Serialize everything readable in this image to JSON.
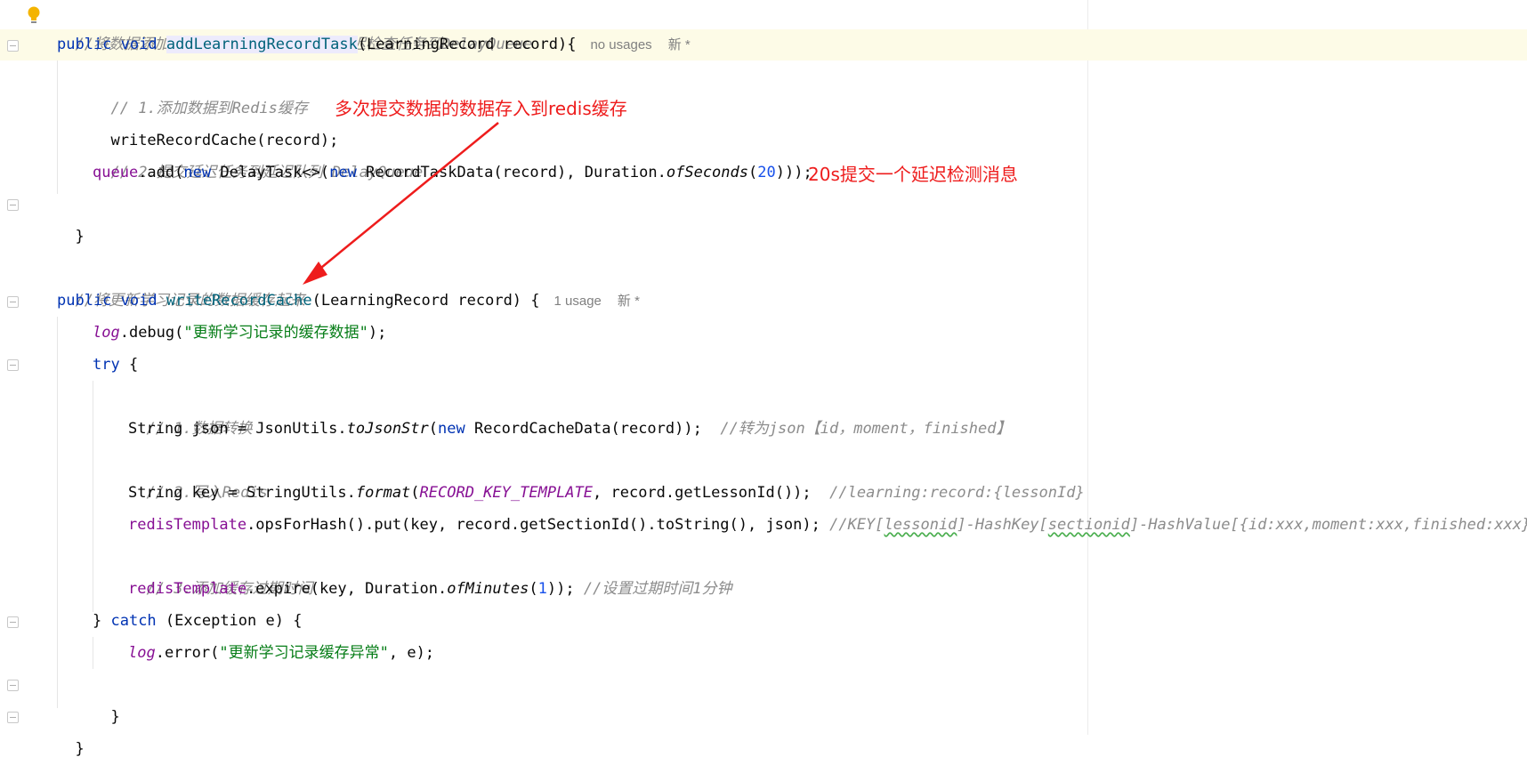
{
  "editor": {
    "lines": {
      "l1_comment": "//将数据添加到redis，并且添加一个延迟检查任务到DelayQueue",
      "l2_public": "public",
      "l2_void": "void",
      "l2_method": "addLearningRecordTask",
      "l2_params": "(LearningRecord record){",
      "l2_usages": "no usages",
      "l2_new": "新 *",
      "l3_comment": "// 1.添加数据到Redis缓存",
      "l4_code": "writeRecordCache(record);",
      "l5_comment": "// 2.提交延迟任务到延迟队列 DelayQueue",
      "l6_queue": "queue",
      "l6_add": ".add(",
      "l6_new1": "new",
      "l6_delay": " DelayTask<>(",
      "l6_new2": "new",
      "l6_rtd": " RecordTaskData(record), Duration.",
      "l6_ofsec": "ofSeconds",
      "l6_open": "(",
      "l6_num": "20",
      "l6_close": ")));",
      "l7_brace": "}",
      "l9_comment": "//将更新学习记录的数据缓存起来",
      "l10_public": "public",
      "l10_void": "void",
      "l10_method": "writeRecordCache",
      "l10_params": "(LearningRecord record) {",
      "l10_usages": "1 usage",
      "l10_new": "新 *",
      "l11_log": "log",
      "l11_debug": ".debug(",
      "l11_str": "\"更新学习记录的缓存数据\"",
      "l11_end": ");",
      "l12_try": "try",
      "l12_brace": " {",
      "l13_comment": "// 1.数据转换",
      "l14_a": "String json = JsonUtils.",
      "l14_tojson": "toJsonStr",
      "l14_b": "(",
      "l14_new": "new",
      "l14_c": " RecordCacheData(record));",
      "l14_comment": "//转为json【id，moment，finished】",
      "l15_comment": "// 2.写入Redis",
      "l16_a": "String key = StringUtils.",
      "l16_format": "format",
      "l16_b": "(",
      "l16_const": "RECORD_KEY_TEMPLATE",
      "l16_c": ", record.getLessonId());",
      "l16_comment": "//learning:record:{lessonId}",
      "l17_field": "redisTemplate",
      "l17_a": ".opsForHash().put(key, record.getSectionId().toString(), json);",
      "l17_c1": "//KEY[",
      "l17_c2": "lessonid",
      "l17_c3": "]-HashKey[",
      "l17_c4": "sectionid",
      "l17_c5": "]-HashValue[{id:xxx,moment:xxx,finished:xxx}]",
      "l18_comment": "// 3.添加缓存过期时间",
      "l19_field": "redisTemplate",
      "l19_a": ".expire(key, Duration.",
      "l19_ofmin": "ofMinutes",
      "l19_b": "(",
      "l19_num": "1",
      "l19_c": "));",
      "l19_comment": "//设置过期时间1分钟",
      "l20_a": "} ",
      "l20_catch": "catch",
      "l20_b": " (Exception e) {",
      "l21_log": "log",
      "l21_a": ".error(",
      "l21_str": "\"更新学习记录缓存异常\"",
      "l21_b": ", e);",
      "l22_brace": "}",
      "l23_brace": "}"
    }
  },
  "annotations": {
    "note1": "多次提交数据的数据存入到redis缓存",
    "note2": "20s提交一个延迟检测消息",
    "color": "#ee1c1c"
  },
  "icons": [
    "intention-bulb-icon",
    "fold-marker-icon"
  ]
}
